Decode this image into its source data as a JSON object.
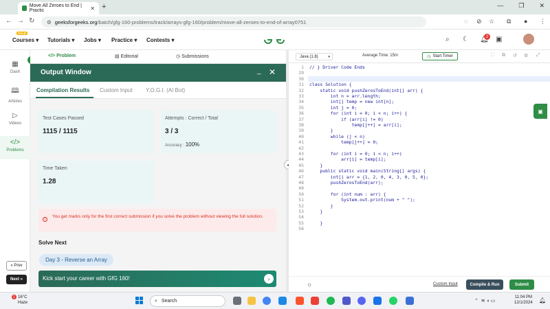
{
  "browser": {
    "tab_title": "Move All Zeroes to End | Practic",
    "new_tab": "+",
    "url_domain": "geeksforgeeks.org",
    "url_path": "/batch/gfg-160-problems/track/arrays-gfg-160/problem/move-all-zeroes-to-end-of-array0751"
  },
  "header": {
    "sale_badge": "SALE",
    "nav": [
      "Courses",
      "Tutorials",
      "Jobs",
      "Practice",
      "Contests"
    ],
    "logo_text": "GfG",
    "notification_count": "2"
  },
  "sidebar": {
    "items": [
      {
        "label": "Dash",
        "icon": "dashboard-icon"
      },
      {
        "label": "Articles",
        "icon": "book-icon"
      },
      {
        "label": "Videos",
        "icon": "video-icon"
      },
      {
        "label": "Problems",
        "icon": "code-icon"
      }
    ],
    "prev_label": "« Prev",
    "next_label": "Next »"
  },
  "problem_tabs": [
    "Problem",
    "Editorial",
    "Submissions"
  ],
  "output": {
    "title": "Output Window",
    "tabs": [
      "Compilation Results",
      "Custom Input",
      "Y.O.G.I. (AI Bot)"
    ],
    "test_cases_label": "Test Cases Passed",
    "test_cases_value": "1115 / 1115",
    "attempts_label": "Attempts : Correct / Total",
    "attempts_value": "3 / 3",
    "accuracy_label": "Accuracy :",
    "accuracy_value": "100%",
    "time_label": "Time Taken",
    "time_value": "1.28",
    "warning": "You get marks only for the first correct submission if you solve the problem without viewing the full solution.",
    "solve_next": "Solve Next",
    "next_problem": "Day 3 - Reverse an Array",
    "banner": "Kick start your career with GfG 160!"
  },
  "editor": {
    "language": "Java (1.8)",
    "avg_time": "Average Time: 15m",
    "timer_label": "Start Timer",
    "lines": [
      {
        "n": "1",
        "text": "// } Driver Code Ends"
      },
      {
        "n": "29",
        "text": ""
      },
      {
        "n": "30",
        "text": ""
      },
      {
        "n": "31",
        "text": "class Solution {"
      },
      {
        "n": "32",
        "text": "    static void pushZerosToEnd(int[] arr) {"
      },
      {
        "n": "33",
        "text": "        int n = arr.length;"
      },
      {
        "n": "34",
        "text": "        int[] temp = new int[n];"
      },
      {
        "n": "35",
        "text": "        int j = 0;"
      },
      {
        "n": "36",
        "text": "        for (int i = 0; i < n; i++) {"
      },
      {
        "n": "37",
        "text": "            if (arr[i] != 0)"
      },
      {
        "n": "38",
        "text": "                temp[j++] = arr[i];"
      },
      {
        "n": "39",
        "text": "        }"
      },
      {
        "n": "40",
        "text": "        while (j < n)"
      },
      {
        "n": "41",
        "text": "            temp[j++] = 0;"
      },
      {
        "n": "42",
        "text": ""
      },
      {
        "n": "43",
        "text": "        for (int i = 0; i < n; i++)"
      },
      {
        "n": "44",
        "text": "            arr[i] = temp[i];"
      },
      {
        "n": "45",
        "text": "    }"
      },
      {
        "n": "46",
        "text": "    public static void main(String[] args) {"
      },
      {
        "n": "47",
        "text": "        int[] arr = {1, 2, 0, 4, 3, 0, 5, 0};"
      },
      {
        "n": "48",
        "text": "        pushZerosToEnd(arr);"
      },
      {
        "n": "49",
        "text": ""
      },
      {
        "n": "50",
        "text": "        for (int num : arr) {"
      },
      {
        "n": "51",
        "text": "            System.out.print(num + \" \");"
      },
      {
        "n": "52",
        "text": "        }"
      },
      {
        "n": "53",
        "text": "    }"
      },
      {
        "n": "54",
        "text": ""
      },
      {
        "n": "55",
        "text": "    }"
      },
      {
        "n": "56",
        "text": ""
      }
    ],
    "custom_input": "Custom Input",
    "compile_label": "Compile & Run",
    "submit_label": "Submit"
  },
  "taskbar": {
    "temperature": "16°C",
    "condition": "Haze",
    "weather_badge": "1",
    "search_label": "Search",
    "time": "11:04 PM",
    "date": "12/1/2024"
  },
  "colors": {
    "gfg_green": "#2f8d46",
    "output_header": "#2b6a56",
    "card_bg": "#e9f6f5",
    "warning_red": "#d93025"
  }
}
